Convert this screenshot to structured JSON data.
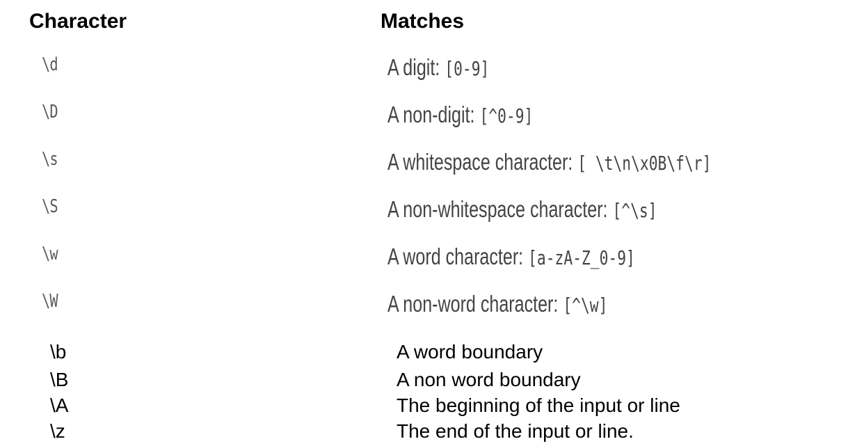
{
  "headers": {
    "character": "Character",
    "matches": "Matches"
  },
  "upper_rows": [
    {
      "char": "\\d",
      "desc": "A digit: ",
      "code": "[0-9]"
    },
    {
      "char": "\\D",
      "desc": "A non-digit: ",
      "code": "[^0-9]"
    },
    {
      "char": "\\s",
      "desc": "A whitespace character: ",
      "code": "[ \\t\\n\\x0B\\f\\r]"
    },
    {
      "char": "\\S",
      "desc": "A non-whitespace character: ",
      "code": "[^\\s]"
    },
    {
      "char": "\\w",
      "desc": "A word character: ",
      "code": "[a-zA-Z_0-9]"
    },
    {
      "char": "\\W",
      "desc": "A non-word character: ",
      "code": "[^\\w]"
    }
  ],
  "lower_rows": [
    {
      "char": "\\b",
      "desc": "A word boundary"
    },
    {
      "char": "\\B",
      "desc": "A non word boundary"
    },
    {
      "char": "\\A",
      "desc": "The beginning of the input or line"
    },
    {
      "char": "\\z",
      "desc": "The end of the input or line."
    }
  ]
}
